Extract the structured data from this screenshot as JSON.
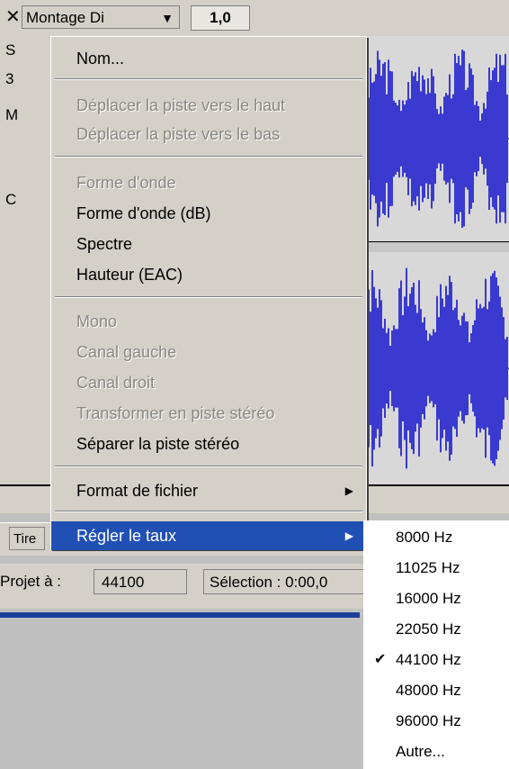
{
  "track": {
    "close_label": "✕",
    "name": "Montage Di",
    "dropdown_icon": "▼",
    "gain_value": "1,0"
  },
  "left_slivers": [
    "S",
    "3",
    "M",
    "C"
  ],
  "context_menu": {
    "items": [
      {
        "label": "Nom...",
        "enabled": true
      },
      {
        "label": "Déplacer la piste vers le haut",
        "enabled": false
      },
      {
        "label": "Déplacer la piste vers le bas",
        "enabled": false
      },
      {
        "label": "Forme d'onde",
        "enabled": false
      },
      {
        "label": "Forme d'onde (dB)",
        "enabled": true
      },
      {
        "label": "Spectre",
        "enabled": true
      },
      {
        "label": "Hauteur (EAC)",
        "enabled": true
      },
      {
        "label": "Mono",
        "enabled": false
      },
      {
        "label": "Canal gauche",
        "enabled": false
      },
      {
        "label": "Canal droit",
        "enabled": false
      },
      {
        "label": "Transformer en piste stéréo",
        "enabled": false
      },
      {
        "label": "Séparer la piste stéréo",
        "enabled": true
      },
      {
        "label": "Format de fichier",
        "enabled": true,
        "submenu": true
      },
      {
        "label": "Régler le taux",
        "enabled": true,
        "submenu": true,
        "highlighted": true
      }
    ]
  },
  "rate_submenu": {
    "items": [
      {
        "label": "8000 Hz",
        "checked": false
      },
      {
        "label": "11025 Hz",
        "checked": false
      },
      {
        "label": "16000 Hz",
        "checked": false
      },
      {
        "label": "22050 Hz",
        "checked": false
      },
      {
        "label": "44100 Hz",
        "checked": true
      },
      {
        "label": "48000 Hz",
        "checked": false
      },
      {
        "label": "96000 Hz",
        "checked": false
      },
      {
        "label": "Autre...",
        "checked": false
      }
    ]
  },
  "toolbar": {
    "tool_label": "Tire"
  },
  "status": {
    "project_label": "Projet à :",
    "project_rate": "44100",
    "selection_label": "Sélection : 0:00,0"
  },
  "colors": {
    "waveform": "#3a3ad0",
    "menu_highlight": "#2150b5",
    "bottom_strip": "#1e3f99"
  }
}
